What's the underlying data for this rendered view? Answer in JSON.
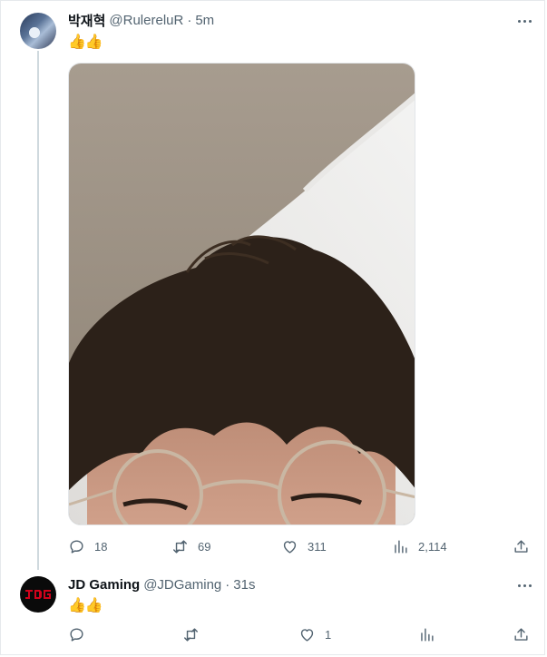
{
  "tweets": [
    {
      "display_name": "박재혁",
      "handle": "@RulereluR",
      "separator": "·",
      "time": "5m",
      "text": "👍👍",
      "more_icon": "more-horizontal-icon",
      "stats": {
        "replies": "18",
        "retweets": "69",
        "likes": "311",
        "views": "2,114"
      }
    },
    {
      "display_name": "JD Gaming",
      "handle": "@JDGaming",
      "separator": "·",
      "time": "31s",
      "text": "👍👍",
      "more_icon": "more-horizontal-icon",
      "stats": {
        "replies": "",
        "retweets": "",
        "likes": "1",
        "views": ""
      }
    }
  ],
  "icons": [
    "reply-icon",
    "retweet-icon",
    "like-icon",
    "views-icon",
    "share-icon"
  ],
  "colors": {
    "text": "#0f1419",
    "secondary": "#536471",
    "thread_line": "#cfd9de",
    "logo_red": "#d0021b"
  }
}
